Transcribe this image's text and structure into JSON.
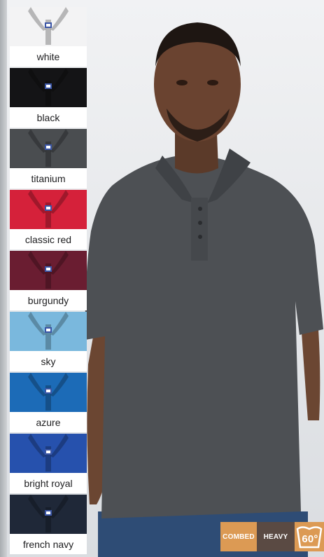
{
  "colors": {
    "hero_shirt": "#4d5054",
    "badge_orange": "#dc9a54",
    "badge_brown": "#5a4a43"
  },
  "swatches": [
    {
      "label": "white",
      "color": "#f3f3f4"
    },
    {
      "label": "black",
      "color": "#141416"
    },
    {
      "label": "titanium",
      "color": "#4a4d50"
    },
    {
      "label": "classic red",
      "color": "#d5213a"
    },
    {
      "label": "burgundy",
      "color": "#6a1d31"
    },
    {
      "label": "sky",
      "color": "#7ab8dd"
    },
    {
      "label": "azure",
      "color": "#1c6bb7"
    },
    {
      "label": "bright royal",
      "color": "#2651ad"
    },
    {
      "label": "french navy",
      "color": "#1f2838"
    }
  ],
  "badges": {
    "combed": "COMBED",
    "heavy": "HEAVY",
    "wash_temp": "60°",
    "wash_icon": "wash-tub-icon"
  }
}
